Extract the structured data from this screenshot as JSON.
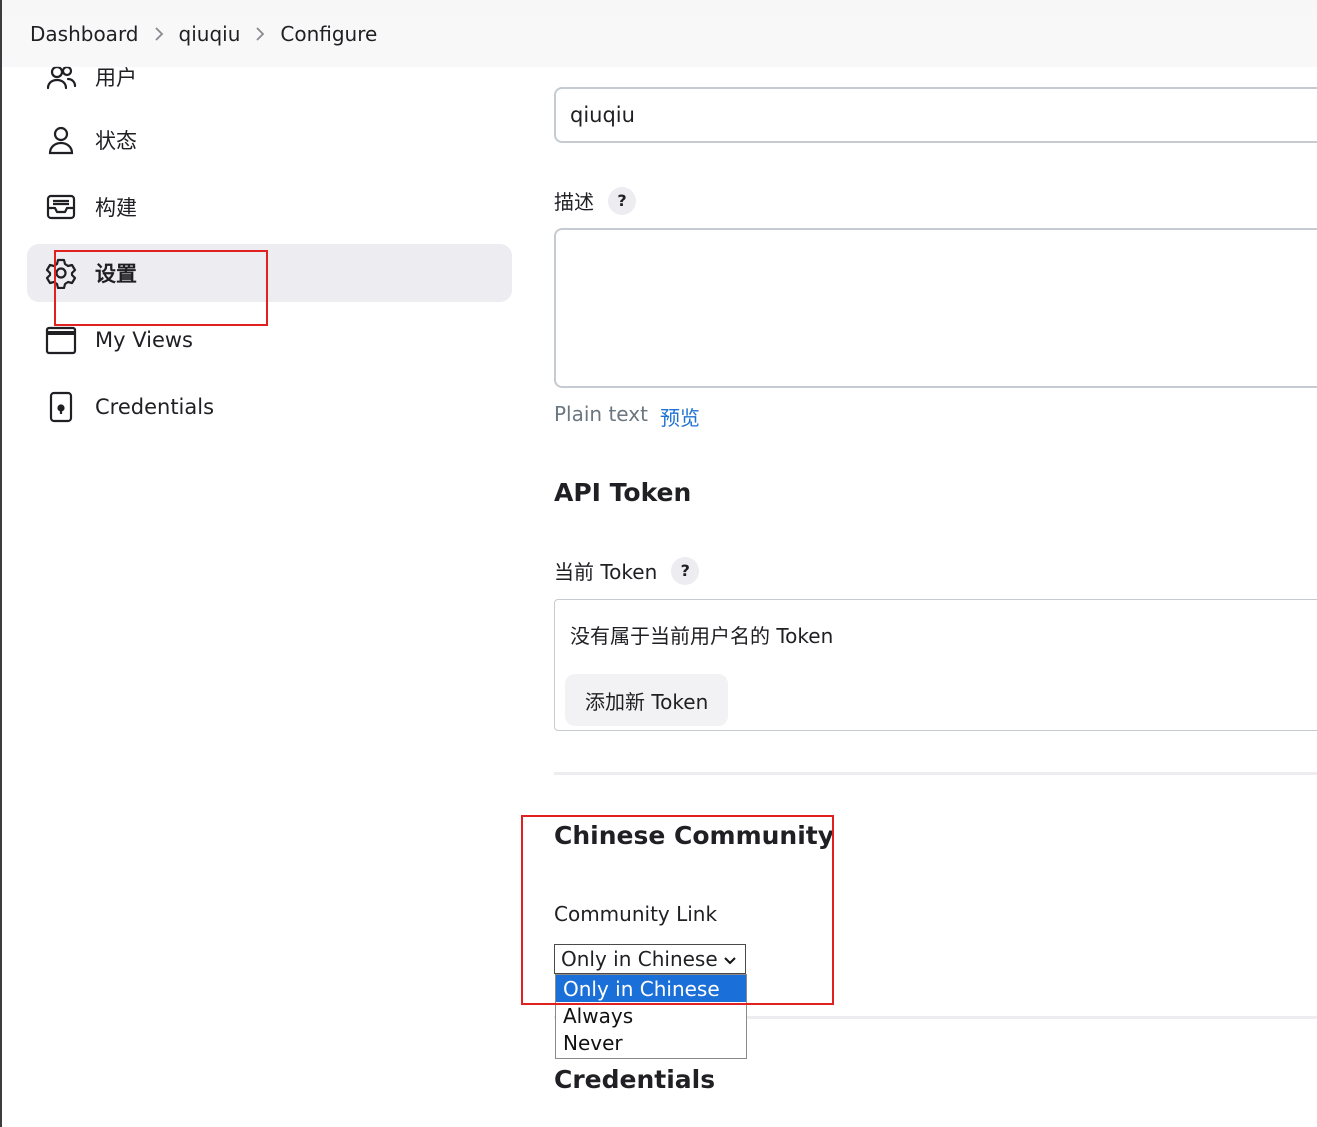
{
  "breadcrumb": {
    "items": [
      "Dashboard",
      "qiuqiu",
      "Configure"
    ]
  },
  "sidebar": {
    "items": [
      {
        "label": "用户",
        "icon": "users-icon"
      },
      {
        "label": "状态",
        "icon": "user-icon"
      },
      {
        "label": "构建",
        "icon": "inbox-icon"
      },
      {
        "label": "设置",
        "icon": "gear-icon",
        "active": true
      },
      {
        "label": "My Views",
        "icon": "window-icon"
      },
      {
        "label": "Credentials",
        "icon": "phone-key-icon"
      }
    ]
  },
  "form": {
    "fullname_value": "qiuqiu",
    "description_label": "描述",
    "help_glyph": "?",
    "format_plain": "Plain text",
    "format_preview": "预览",
    "api_token_title": "API Token",
    "current_token_label": "当前 Token",
    "no_token_text": "没有属于当前用户名的 Token",
    "add_token_button": "添加新 Token",
    "community_title": "Chinese Community",
    "community_link_label": "Community Link",
    "community_select_value": "Only in Chinese",
    "community_options": [
      "Only in Chinese",
      "Always",
      "Never"
    ],
    "credentials_title": "Credentials"
  },
  "colors": {
    "accent": "#1f72d2",
    "highlight_red": "#e0211f",
    "selected_option": "#1b6fd8"
  }
}
